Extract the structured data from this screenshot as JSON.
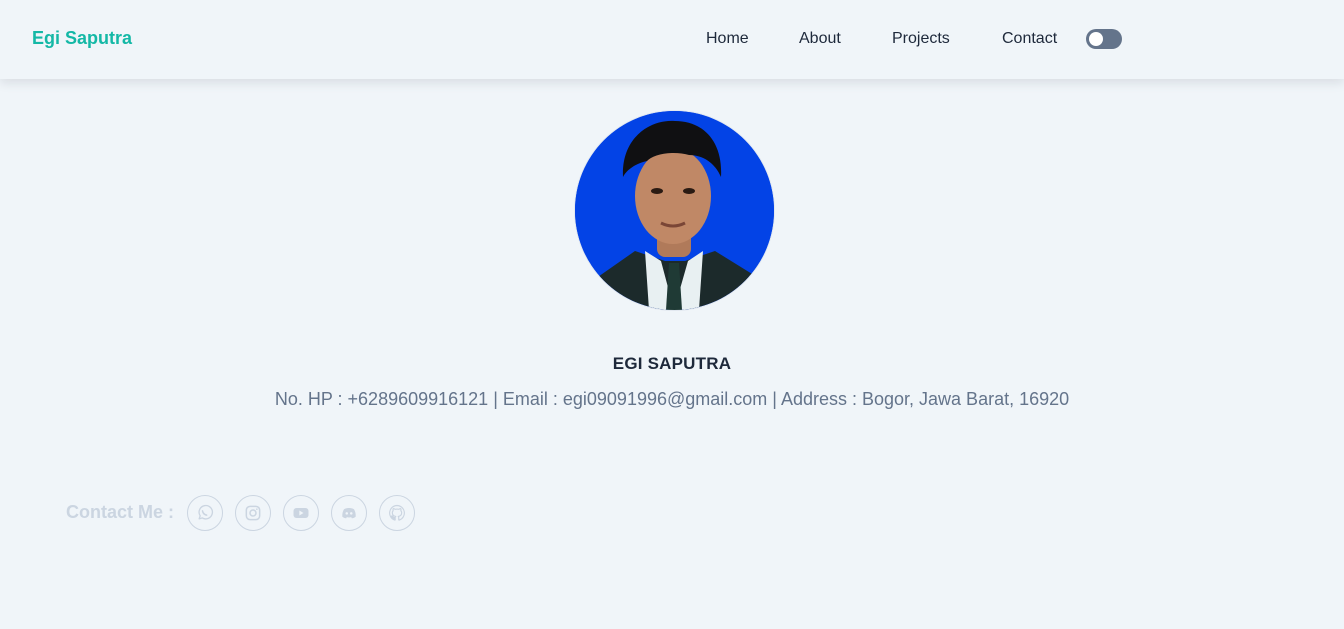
{
  "header": {
    "brand": "Egi Saputra",
    "nav": [
      "Home",
      "About",
      "Projects",
      "Contact"
    ],
    "theme_toggle": {
      "icon": "toggle-switch",
      "state": "off"
    }
  },
  "profile": {
    "photo_alt": "Egi Saputra",
    "name": "EGI SAPUTRA",
    "details": "No. HP : +6289609916121 | Email : egi09091996@gmail.com | Address : Bogor, Jawa Barat, 16920"
  },
  "contact": {
    "label": "Contact Me :",
    "icons": [
      "whatsapp-icon",
      "instagram-icon",
      "youtube-icon",
      "discord-icon",
      "github-icon"
    ]
  },
  "colors": {
    "accent": "#14b8a6",
    "background": "#f0f5f9",
    "text_dark": "#1e293b",
    "text_muted": "#64748b",
    "faded": "#cbd5e1",
    "photo_background": "#0343e6"
  }
}
